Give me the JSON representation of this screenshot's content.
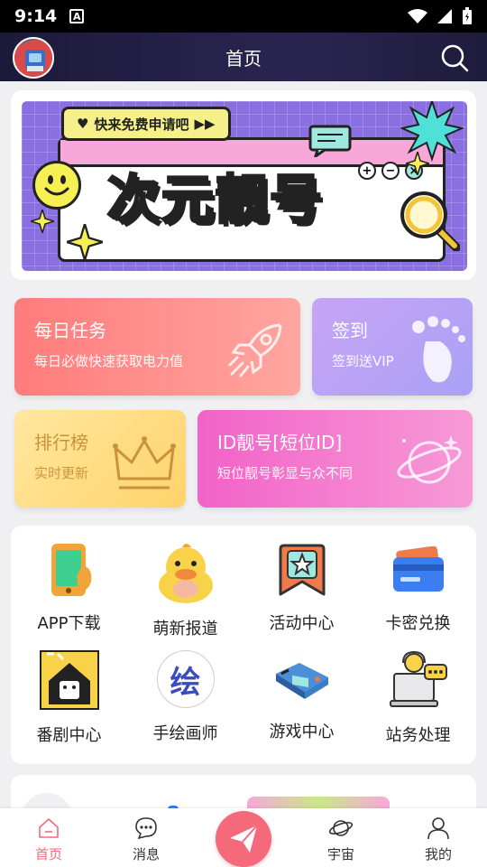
{
  "status": {
    "time": "9:14",
    "notif_glyph": "A"
  },
  "header": {
    "title": "首页"
  },
  "banner": {
    "pill_text": "快来免费申请吧",
    "title": "次元靓号"
  },
  "tiles": {
    "daily": {
      "title": "每日任务",
      "subtitle": "每日必做快速获取电力值"
    },
    "signin": {
      "title": "签到",
      "subtitle": "签到送VIP"
    },
    "rank": {
      "title": "排行榜",
      "subtitle": "实时更新"
    },
    "idnum": {
      "title": "ID靓号[短位ID]",
      "subtitle": "短位靓号彰显与众不同"
    }
  },
  "grid": {
    "items": [
      {
        "label": "APP下载",
        "icon": "phone-icon"
      },
      {
        "label": "萌新报道",
        "icon": "duck-mascot-icon"
      },
      {
        "label": "活动中心",
        "icon": "star-bookmark-icon"
      },
      {
        "label": "卡密兑换",
        "icon": "card-wallet-icon"
      },
      {
        "label": "番剧中心",
        "icon": "house-oh-icon"
      },
      {
        "label": "手绘画师",
        "icon": "paint-logo-icon"
      },
      {
        "label": "游戏中心",
        "icon": "game-console-icon"
      },
      {
        "label": "站务处理",
        "icon": "support-laptop-icon"
      }
    ],
    "paint_logo_char": "绘"
  },
  "nav": {
    "items": [
      {
        "label": "首页",
        "active": true
      },
      {
        "label": "消息",
        "active": false
      },
      {
        "label": "宇宙",
        "active": false
      },
      {
        "label": "我的",
        "active": false
      }
    ]
  },
  "colors": {
    "accent": "#f46a7a",
    "header_bg": "#1c1a3a",
    "banner_bg": "#8a6fe0"
  }
}
